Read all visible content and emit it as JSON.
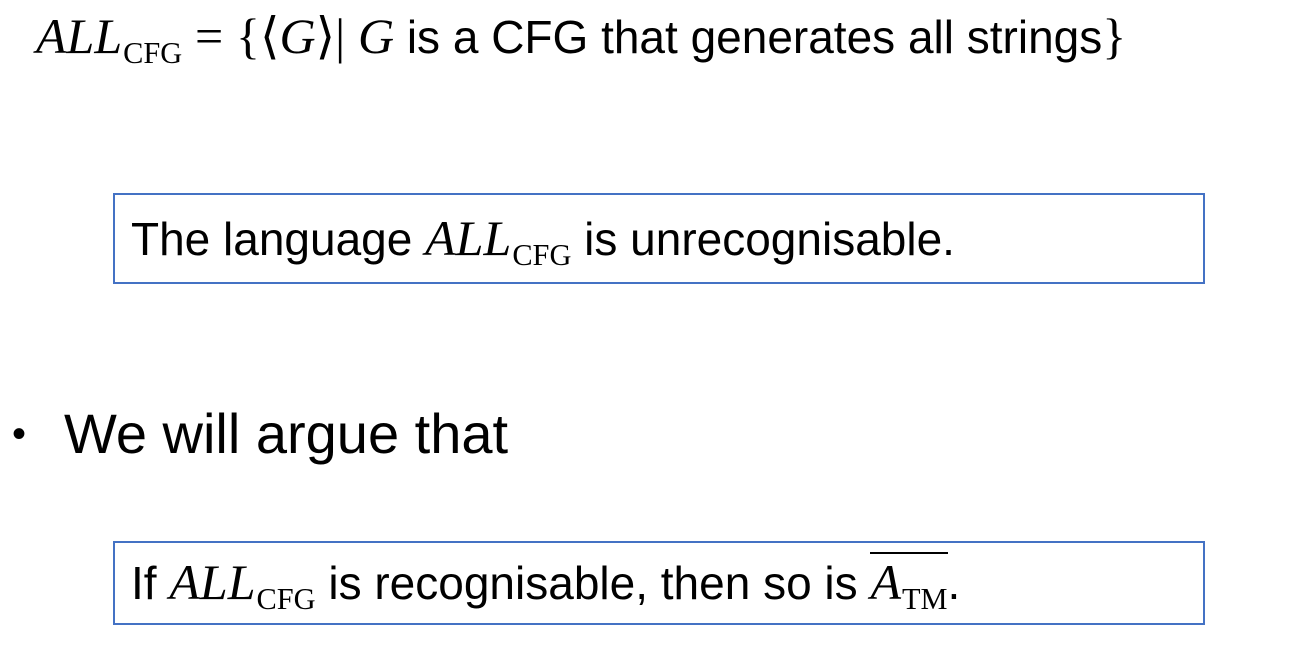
{
  "definition": {
    "lang_name": "ALL",
    "lang_sub": "CFG",
    "equals": "=",
    "lbrace": "{",
    "langle": "⟨",
    "var": "G",
    "rangle": "⟩",
    "bar": "|",
    "var2": "G",
    "text": "is a CFG that generates all strings",
    "rbrace": "}"
  },
  "claim_box": {
    "prefix": "The language",
    "lang_name": "ALL",
    "lang_sub": "CFG",
    "suffix": "is unrecognisable."
  },
  "bullet": {
    "marker": "•",
    "text": "We will argue that"
  },
  "implication_box": {
    "prefix": "If",
    "lang_name": "ALL",
    "lang_sub": "CFG",
    "middle": "is recognisable, then so is",
    "other_name": "A",
    "other_sub": "TM",
    "period": "."
  },
  "colors": {
    "box_border": "#4472c4",
    "text": "#000000"
  }
}
